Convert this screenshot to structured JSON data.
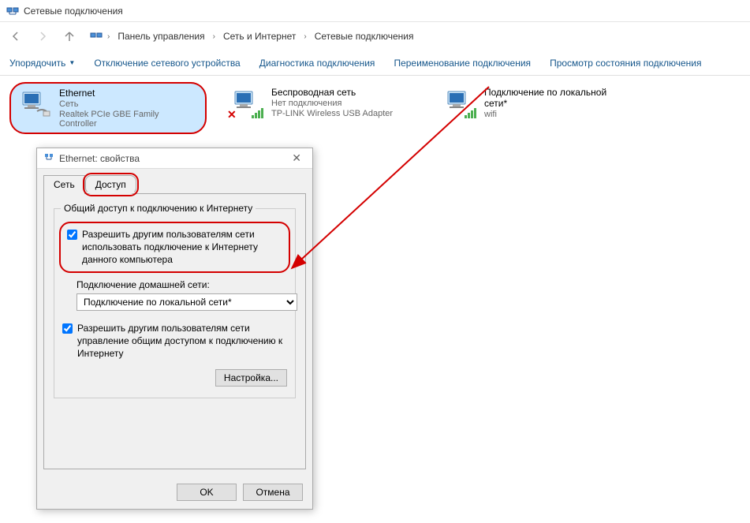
{
  "window": {
    "title": "Сетевые подключения"
  },
  "breadcrumb": {
    "root": "Панель управления",
    "mid": "Сеть и Интернет",
    "leaf": "Сетевые подключения"
  },
  "toolbar": {
    "organize": "Упорядочить",
    "disable": "Отключение сетевого устройства",
    "diagnose": "Диагностика подключения",
    "rename": "Переименование подключения",
    "status": "Просмотр состояния подключения"
  },
  "connections": [
    {
      "name": "Ethernet",
      "status": "Сеть",
      "device": "Realtek PCIe GBE Family Controller"
    },
    {
      "name": "Беспроводная сеть",
      "status": "Нет подключения",
      "device": "TP-LINK Wireless USB Adapter"
    },
    {
      "name": "Подключение по локальной сети*",
      "status": "",
      "device": "wifi"
    }
  ],
  "dialog": {
    "title": "Ethernet: свойства",
    "tabs": {
      "network": "Сеть",
      "sharing": "Доступ"
    },
    "group_title": "Общий доступ к подключению к Интернету",
    "chk1": "Разрешить другим пользователям сети использовать подключение к Интернету данного компьютера",
    "home_label": "Подключение домашней сети:",
    "home_value": "Подключение по локальной сети*",
    "chk2": "Разрешить другим пользователям сети управление общим доступом к подключению к Интернету",
    "settings_btn": "Настройка...",
    "ok": "OK",
    "cancel": "Отмена"
  }
}
